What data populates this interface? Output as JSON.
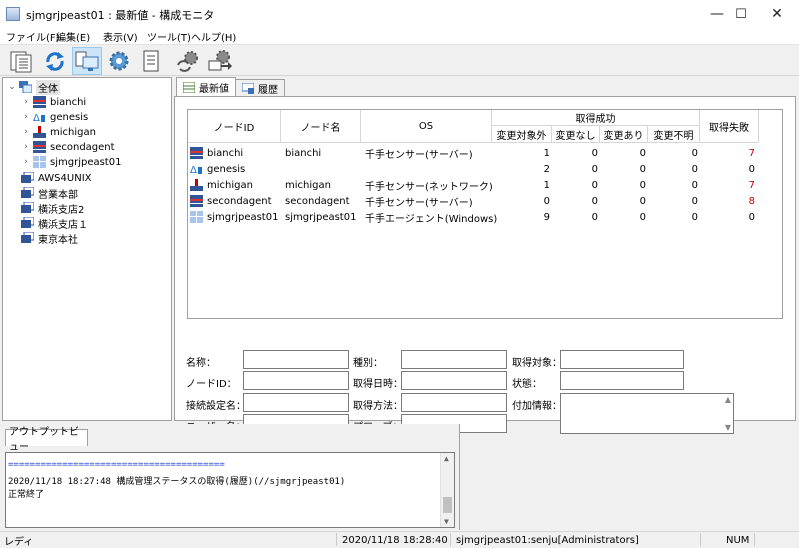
{
  "window": {
    "title": "sjmgrjpeast01 : 最新値 - 構成モニタ",
    "minimize": "—",
    "maximize": "☐",
    "close": "✕"
  },
  "menu": [
    "ファイル(F)",
    "編集(E)",
    "表示(V)",
    "ツール(T)",
    "ヘルプ(H)"
  ],
  "toolbar": {
    "buttons": [
      "properties-icon",
      "refresh-icon",
      "monitor-icon",
      "settings-icon",
      "report-icon",
      "sync-settings-icon",
      "export-icon"
    ]
  },
  "tree": {
    "root": "全体",
    "children": [
      "bianchi",
      "genesis",
      "michigan",
      "secondagent",
      "sjmgrjpeast01"
    ],
    "groups": [
      "AWS4UNIX",
      "営業本部",
      "横浜支店2",
      "横浜支店１",
      "東京本社"
    ]
  },
  "tabs": [
    "最新値",
    "履歴"
  ],
  "grid": {
    "headers": {
      "nodeid": "ノードID",
      "nodename": "ノード名",
      "os": "OS",
      "success_group": "取得成功",
      "excluded": "変更対象外",
      "nochange": "変更なし",
      "changed": "変更あり",
      "unknown": "変更不明",
      "failed": "取得失敗"
    },
    "rows": [
      {
        "id": "bianchi",
        "name": "bianchi",
        "os": "千手センサー(サーバー)",
        "excluded": "1",
        "nochange": "0",
        "changed": "0",
        "unknown": "0",
        "failed": "7",
        "icon": "server-icon"
      },
      {
        "id": "genesis",
        "name": "",
        "os": "",
        "excluded": "2",
        "nochange": "0",
        "changed": "0",
        "unknown": "0",
        "failed": "0",
        "icon": "cluster-icon"
      },
      {
        "id": "michigan",
        "name": "michigan",
        "os": "千手センサー(ネットワーク)",
        "excluded": "1",
        "nochange": "0",
        "changed": "0",
        "unknown": "0",
        "failed": "7",
        "icon": "network-icon"
      },
      {
        "id": "secondagent",
        "name": "secondagent",
        "os": "千手センサー(サーバー)",
        "excluded": "0",
        "nochange": "0",
        "changed": "0",
        "unknown": "0",
        "failed": "8",
        "icon": "server-icon"
      },
      {
        "id": "sjmgrjpeast01",
        "name": "sjmgrjpeast01",
        "os": "千手エージェント(Windows)",
        "excluded": "9",
        "nochange": "0",
        "changed": "0",
        "unknown": "0",
        "failed": "0",
        "icon": "agent-icon"
      }
    ]
  },
  "details": {
    "name_label": "名称：",
    "type_label": "種別：",
    "target_label": "取得対象：",
    "nodeid_label": "ノードID：",
    "datetime_label": "取得日時：",
    "state_label": "状態：",
    "conn_label": "接続設定名：",
    "method_label": "取得方法：",
    "extra_label": "付加情報：",
    "user_label": "ユーザー名：",
    "probe_label": "プローブ："
  },
  "output": {
    "tab": "アウトプットビュー",
    "lines": [
      "========================================",
      "2020/11/18 18:27:48 構成管理ステータスの取得(履歴)(//sjmgrjpeast01)",
      "正常終了"
    ]
  },
  "status": {
    "ready": "レディ",
    "datetime": "2020/11/18 18:28:40",
    "user": "sjmgrjpeast01:senju[Administrators]",
    "num": "NUM"
  },
  "colors": {
    "failed_red": "#c00000",
    "accent": "#cce4f7"
  }
}
